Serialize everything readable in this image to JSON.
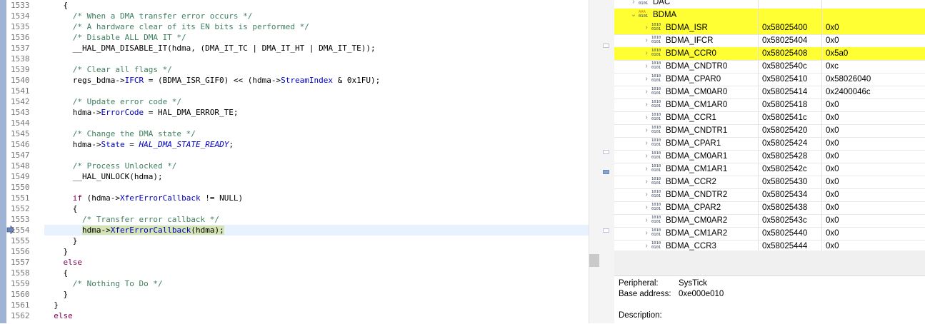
{
  "editor": {
    "lines": [
      {
        "num": "1533",
        "segs": [
          {
            "t": "    {",
            "c": ""
          }
        ]
      },
      {
        "num": "1534",
        "segs": [
          {
            "t": "      /* When a DMA transfer error occurs */",
            "c": "cm"
          }
        ]
      },
      {
        "num": "1535",
        "segs": [
          {
            "t": "      /* A hardware clear of its EN bits is performed */",
            "c": "cm"
          }
        ]
      },
      {
        "num": "1536",
        "segs": [
          {
            "t": "      /* Disable ALL DMA IT */",
            "c": "cm"
          }
        ]
      },
      {
        "num": "1537",
        "segs": [
          {
            "t": "      __HAL_DMA_DISABLE_IT(hdma, (DMA_IT_TC | DMA_IT_HT | DMA_IT_TE));",
            "c": ""
          }
        ]
      },
      {
        "num": "1538",
        "segs": []
      },
      {
        "num": "1539",
        "segs": [
          {
            "t": "      /* Clear all flags */",
            "c": "cm"
          }
        ]
      },
      {
        "num": "1540",
        "segs": [
          {
            "t": "      regs_bdma->",
            "c": ""
          },
          {
            "t": "IFCR",
            "c": "fld"
          },
          {
            "t": " = (BDMA_ISR_GIF0) << (hdma->",
            "c": ""
          },
          {
            "t": "StreamIndex",
            "c": "fld"
          },
          {
            "t": " & 0x1FU);",
            "c": ""
          }
        ]
      },
      {
        "num": "1541",
        "segs": []
      },
      {
        "num": "1542",
        "segs": [
          {
            "t": "      /* Update error code */",
            "c": "cm"
          }
        ]
      },
      {
        "num": "1543",
        "segs": [
          {
            "t": "      hdma->",
            "c": ""
          },
          {
            "t": "ErrorCode",
            "c": "fld"
          },
          {
            "t": " = HAL_DMA_ERROR_TE;",
            "c": ""
          }
        ]
      },
      {
        "num": "1544",
        "segs": []
      },
      {
        "num": "1545",
        "segs": [
          {
            "t": "      /* Change the DMA state */",
            "c": "cm"
          }
        ]
      },
      {
        "num": "1546",
        "segs": [
          {
            "t": "      hdma->",
            "c": ""
          },
          {
            "t": "State",
            "c": "fld"
          },
          {
            "t": " = ",
            "c": ""
          },
          {
            "t": "HAL_DMA_STATE_READY",
            "c": "enum"
          },
          {
            "t": ";",
            "c": ""
          }
        ]
      },
      {
        "num": "1547",
        "segs": []
      },
      {
        "num": "1548",
        "segs": [
          {
            "t": "      /* Process Unlocked */",
            "c": "cm"
          }
        ]
      },
      {
        "num": "1549",
        "segs": [
          {
            "t": "      __HAL_UNLOCK(hdma);",
            "c": ""
          }
        ]
      },
      {
        "num": "1550",
        "segs": []
      },
      {
        "num": "1551",
        "segs": [
          {
            "t": "      ",
            "c": ""
          },
          {
            "t": "if",
            "c": "kw"
          },
          {
            "t": " (hdma->",
            "c": ""
          },
          {
            "t": "XferErrorCallback",
            "c": "fld"
          },
          {
            "t": " != NULL)",
            "c": ""
          }
        ]
      },
      {
        "num": "1552",
        "segs": [
          {
            "t": "      {",
            "c": ""
          }
        ]
      },
      {
        "num": "1553",
        "segs": [
          {
            "t": "        /* Transfer error callback */",
            "c": "cm"
          }
        ]
      },
      {
        "num": "1554",
        "current": true,
        "segs": [
          {
            "t": "        ",
            "c": ""
          },
          {
            "t": "hdma->",
            "c": "sel"
          },
          {
            "t": "XferErrorCallback",
            "c": "sel fld"
          },
          {
            "t": "(hdma);",
            "c": "sel"
          }
        ]
      },
      {
        "num": "1555",
        "segs": [
          {
            "t": "      }",
            "c": ""
          }
        ]
      },
      {
        "num": "1556",
        "segs": [
          {
            "t": "    }",
            "c": ""
          }
        ]
      },
      {
        "num": "1557",
        "segs": [
          {
            "t": "    ",
            "c": ""
          },
          {
            "t": "else",
            "c": "kw"
          }
        ]
      },
      {
        "num": "1558",
        "segs": [
          {
            "t": "    {",
            "c": ""
          }
        ]
      },
      {
        "num": "1559",
        "segs": [
          {
            "t": "      /* Nothing To Do */",
            "c": "cm"
          }
        ]
      },
      {
        "num": "1560",
        "segs": [
          {
            "t": "    }",
            "c": ""
          }
        ]
      },
      {
        "num": "1561",
        "segs": [
          {
            "t": "  }",
            "c": ""
          }
        ]
      },
      {
        "num": "1562",
        "segs": [
          {
            "t": "  ",
            "c": ""
          },
          {
            "t": "else",
            "c": "kw"
          }
        ]
      }
    ]
  },
  "registers": {
    "rows": [
      {
        "name": "DAC",
        "address": "",
        "value": "",
        "level": 1,
        "expanded": false,
        "group": true,
        "highlight": false
      },
      {
        "name": "BDMA",
        "address": "",
        "value": "",
        "level": 1,
        "expanded": true,
        "group": true,
        "highlight": true
      },
      {
        "name": "BDMA_ISR",
        "address": "0x58025400",
        "value": "0x0",
        "level": 2,
        "highlight": true
      },
      {
        "name": "BDMA_IFCR",
        "address": "0x58025404",
        "value": "0x0",
        "level": 2,
        "highlight": false
      },
      {
        "name": "BDMA_CCR0",
        "address": "0x58025408",
        "value": "0x5a0",
        "level": 2,
        "highlight": true
      },
      {
        "name": "BDMA_CNDTR0",
        "address": "0x5802540c",
        "value": "0xc",
        "level": 2,
        "highlight": false
      },
      {
        "name": "BDMA_CPAR0",
        "address": "0x58025410",
        "value": "0x58026040",
        "level": 2,
        "highlight": false
      },
      {
        "name": "BDMA_CM0AR0",
        "address": "0x58025414",
        "value": "0x2400046c",
        "level": 2,
        "highlight": false
      },
      {
        "name": "BDMA_CM1AR0",
        "address": "0x58025418",
        "value": "0x0",
        "level": 2,
        "highlight": false
      },
      {
        "name": "BDMA_CCR1",
        "address": "0x5802541c",
        "value": "0x0",
        "level": 2,
        "highlight": false
      },
      {
        "name": "BDMA_CNDTR1",
        "address": "0x58025420",
        "value": "0x0",
        "level": 2,
        "highlight": false
      },
      {
        "name": "BDMA_CPAR1",
        "address": "0x58025424",
        "value": "0x0",
        "level": 2,
        "highlight": false
      },
      {
        "name": "BDMA_CM0AR1",
        "address": "0x58025428",
        "value": "0x0",
        "level": 2,
        "highlight": false
      },
      {
        "name": "BDMA_CM1AR1",
        "address": "0x5802542c",
        "value": "0x0",
        "level": 2,
        "highlight": false
      },
      {
        "name": "BDMA_CCR2",
        "address": "0x58025430",
        "value": "0x0",
        "level": 2,
        "highlight": false
      },
      {
        "name": "BDMA_CNDTR2",
        "address": "0x58025434",
        "value": "0x0",
        "level": 2,
        "highlight": false
      },
      {
        "name": "BDMA_CPAR2",
        "address": "0x58025438",
        "value": "0x0",
        "level": 2,
        "highlight": false
      },
      {
        "name": "BDMA_CM0AR2",
        "address": "0x5802543c",
        "value": "0x0",
        "level": 2,
        "highlight": false
      },
      {
        "name": "BDMA_CM1AR2",
        "address": "0x58025440",
        "value": "0x0",
        "level": 2,
        "highlight": false
      },
      {
        "name": "BDMA_CCR3",
        "address": "0x58025444",
        "value": "0x0",
        "level": 2,
        "highlight": false
      }
    ]
  },
  "details": {
    "peripheral_label": "Peripheral:",
    "peripheral_value": "SysTick",
    "base_label": "Base address:",
    "base_value": "0xe000e010",
    "description_label": "Description:"
  },
  "icons": {
    "register": "register-binary-icon",
    "peripheral": "peripheral-binary-icon",
    "expand": "chevron-right-icon",
    "collapse": "chevron-down-icon",
    "instruction_pointer": "instruction-pointer-icon"
  },
  "colors": {
    "highlight": "#ffff33",
    "current_line": "#e8f2fe",
    "selection": "#d4e4b4",
    "comment": "#3f7f5f",
    "field": "#0000c0",
    "keyword": "#7f0055"
  }
}
